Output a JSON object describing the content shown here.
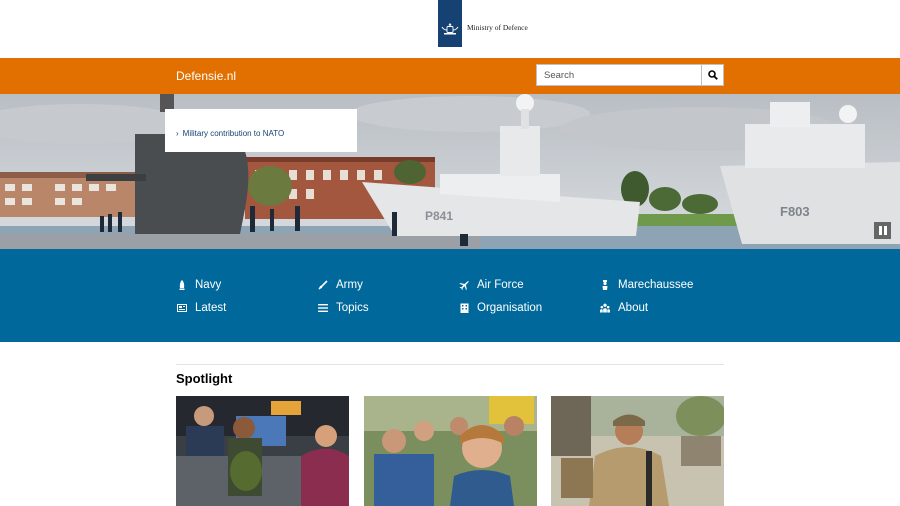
{
  "header": {
    "logo_text": "Ministry of Defence"
  },
  "topbar": {
    "site_name": "Defensie.nl",
    "search": {
      "placeholder": "Search",
      "value": ""
    },
    "search_icon": "magnifier-icon"
  },
  "hero": {
    "link_label": "Military contribution to NATO",
    "pause_icon": "pause-icon"
  },
  "nav": {
    "items": [
      {
        "label": "Navy",
        "icon": "anchor-icon"
      },
      {
        "label": "Latest",
        "icon": "news-icon"
      },
      {
        "label": "Army",
        "icon": "rifle-icon"
      },
      {
        "label": "Topics",
        "icon": "list-icon"
      },
      {
        "label": "Air Force",
        "icon": "plane-icon"
      },
      {
        "label": "Organisation",
        "icon": "building-icon"
      },
      {
        "label": "Marechaussee",
        "icon": "officer-icon"
      },
      {
        "label": "About",
        "icon": "people-icon"
      }
    ]
  },
  "spotlight": {
    "title": "Spotlight"
  },
  "colors": {
    "orange": "#e17000",
    "blue": "#01689b",
    "logo_blue": "#154273"
  }
}
